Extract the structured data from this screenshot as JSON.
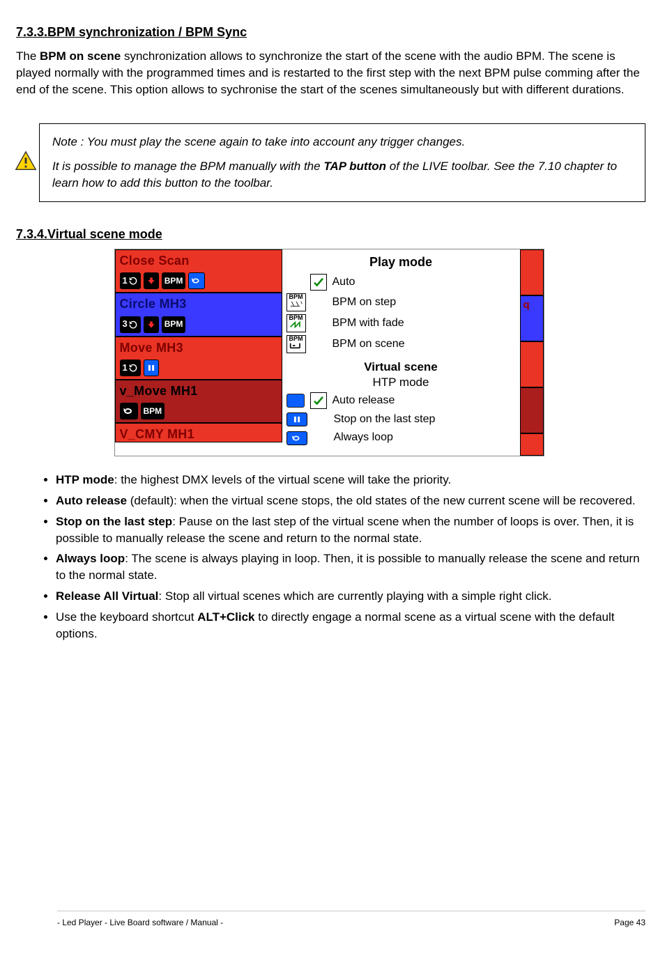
{
  "headings": {
    "section": "7.3.3.BPM synchronization / BPM Sync",
    "sub": "7.3.4.Virtual scene mode"
  },
  "paras": {
    "p1_pre": "The ",
    "p1_b": "BPM on scene",
    "p1_post": " synchronization allows to synchronize the start of the scene with the audio BPM. The scene is played normally with the programmed times and is restarted to the first step with the next BPM pulse comming after the end of the scene. This option allows to sychronise the start of the scenes simultaneously but with different durations."
  },
  "note_p1": "Note : You must play the scene again to take into account any trigger changes.",
  "note_p2_pre": "It is possible to manage the BPM manually with the ",
  "note_p2_b": "TAP button",
  "note_p2_post": " of the LIVE toolbar. See the 7.10 chapter to learn how to add this button to the toolbar.",
  "scenes": {
    "s1": {
      "title": "Close Scan",
      "loop": "1"
    },
    "s2": {
      "title": "Circle MH3",
      "loop": "3"
    },
    "s3": {
      "title": "Move MH3",
      "loop": "1"
    },
    "s4": {
      "title": "v_Move MH1"
    },
    "s5": {
      "title": "V_CMY MH1"
    }
  },
  "menu": {
    "title": "Play mode",
    "auto": "Auto",
    "bpmstep": "BPM on step",
    "bpmfade": "BPM with fade",
    "bpmscene": "BPM on scene",
    "vs_title": "Virtual scene",
    "htp": "HTP mode",
    "autorelease": "Auto release",
    "stoplast": "Stop on the last step",
    "alwaysloop": "Always loop"
  },
  "right": {
    "q": "q"
  },
  "bullets": {
    "b1_b": "HTP mode",
    "b1": ": the highest DMX levels of the virtual scene will take the priority.",
    "b2_b": "Auto release",
    "b2": " (default): when the virtual scene stops, the old states of the new current scene will be recovered.",
    "b3_b": "Stop on the last step",
    "b3": ": Pause on the last step of the virtual scene when the number of loops is over. Then, it is possible to manually release the scene and return to the normal state.",
    "b4_b": "Always loop",
    "b4": ": The scene is always playing in loop. Then, it is possible to manually release the scene and return to the normal state.",
    "b5_b": "Release All Virtual",
    "b5": ": Stop all virtual scenes which are currently playing with a simple right click.",
    "b6_pre": "Use the keyboard shortcut ",
    "b6_b": "ALT+Click",
    "b6_post": " to directly engage a normal scene as a virtual scene with the default options."
  },
  "footer": {
    "left": "- Led Player - Live Board software / Manual -",
    "right": "43",
    "page": "Page"
  }
}
